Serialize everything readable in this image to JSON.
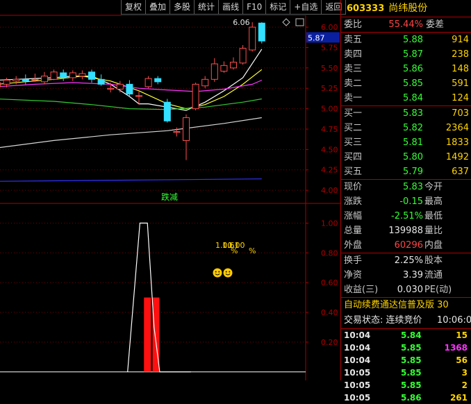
{
  "toolbar": [
    "复权",
    "叠加",
    "多股",
    "统计",
    "画线",
    "F10",
    "标记",
    "+自选",
    "返回"
  ],
  "stock": {
    "code": "603333",
    "name": "尚纬股份"
  },
  "weibi": {
    "label1": "委比",
    "value": "55.44%",
    "label2": "委差"
  },
  "sell_orders": [
    {
      "label": "卖五",
      "price": "5.88",
      "vol": "914"
    },
    {
      "label": "卖四",
      "price": "5.87",
      "vol": "238"
    },
    {
      "label": "卖三",
      "price": "5.86",
      "vol": "148"
    },
    {
      "label": "卖二",
      "price": "5.85",
      "vol": "591"
    },
    {
      "label": "卖一",
      "price": "5.84",
      "vol": "124"
    }
  ],
  "buy_orders": [
    {
      "label": "买一",
      "price": "5.83",
      "vol": "703"
    },
    {
      "label": "买二",
      "price": "5.82",
      "vol": "2364"
    },
    {
      "label": "买三",
      "price": "5.81",
      "vol": "1833"
    },
    {
      "label": "买四",
      "price": "5.80",
      "vol": "1492"
    },
    {
      "label": "买五",
      "price": "5.79",
      "vol": "637"
    }
  ],
  "quote": [
    {
      "label": "现价",
      "value": "5.83",
      "label2": "今开",
      "color": "green"
    },
    {
      "label": "涨跌",
      "value": "-0.15",
      "label2": "最高",
      "color": "green"
    },
    {
      "label": "涨幅",
      "value": "-2.51%",
      "label2": "最低",
      "color": "green"
    },
    {
      "label": "总量",
      "value": "139988",
      "label2": "量比",
      "color": "white"
    },
    {
      "label": "外盘",
      "value": "60296",
      "label2": "内盘",
      "color": "red"
    }
  ],
  "fundamentals": [
    {
      "label": "换手",
      "value": "2.25%",
      "label2": "股本"
    },
    {
      "label": "净资",
      "value": "3.39",
      "label2": "流通"
    },
    {
      "label": "收益(三)",
      "value": "0.030",
      "label2": "PE(动)"
    }
  ],
  "ticker_text": "自动续费通达信普及版 30",
  "status": {
    "label": "交易状态: 连续竞价",
    "time": "10:06:0"
  },
  "trades": [
    {
      "time": "10:04",
      "price": "5.84",
      "vol": "15",
      "pc": "green",
      "vc": "yellow"
    },
    {
      "time": "10:04",
      "price": "5.85",
      "vol": "1368",
      "pc": "green",
      "vc": "mag"
    },
    {
      "time": "10:04",
      "price": "5.85",
      "vol": "56",
      "pc": "green",
      "vc": "yellow"
    },
    {
      "time": "10:05",
      "price": "5.85",
      "vol": "3",
      "pc": "green",
      "vc": "yellow"
    },
    {
      "time": "10:05",
      "price": "5.85",
      "vol": "2",
      "pc": "green",
      "vc": "yellow"
    },
    {
      "time": "10:05",
      "price": "5.86",
      "vol": "261",
      "pc": "green",
      "vc": "yellow"
    }
  ],
  "chart_data": [
    {
      "type": "candlestick",
      "title": "",
      "y_ticks": [
        "6.00",
        "5.75",
        "5.50",
        "5.25",
        "5.00",
        "4.75",
        "4.50",
        "4.25",
        "4.00"
      ],
      "ylim": [
        3.95,
        6.12
      ],
      "current_price_label": "5.87",
      "high_label": "6.06",
      "candles": [
        {
          "o": 5.27,
          "c": 5.32,
          "h": 5.35,
          "l": 5.22
        },
        {
          "o": 5.3,
          "c": 5.35,
          "h": 5.38,
          "l": 5.26
        },
        {
          "o": 5.34,
          "c": 5.36,
          "h": 5.4,
          "l": 5.3
        },
        {
          "o": 5.36,
          "c": 5.34,
          "h": 5.42,
          "l": 5.3
        },
        {
          "o": 5.35,
          "c": 5.36,
          "h": 5.43,
          "l": 5.33
        },
        {
          "o": 5.33,
          "c": 5.4,
          "h": 5.45,
          "l": 5.3
        },
        {
          "o": 5.36,
          "c": 5.45,
          "h": 5.48,
          "l": 5.35
        },
        {
          "o": 5.44,
          "c": 5.38,
          "h": 5.48,
          "l": 5.34
        },
        {
          "o": 5.38,
          "c": 5.44,
          "h": 5.47,
          "l": 5.34
        },
        {
          "o": 5.4,
          "c": 5.43,
          "h": 5.47,
          "l": 5.36
        },
        {
          "o": 5.45,
          "c": 5.36,
          "h": 5.48,
          "l": 5.32
        },
        {
          "o": 5.36,
          "c": 5.3,
          "h": 5.42,
          "l": 5.28
        },
        {
          "o": 5.24,
          "c": 5.25,
          "h": 5.32,
          "l": 5.2
        },
        {
          "o": 5.24,
          "c": 5.3,
          "h": 5.34,
          "l": 5.2
        },
        {
          "o": 5.3,
          "c": 5.18,
          "h": 5.35,
          "l": 5.14
        },
        {
          "o": 5.16,
          "c": 5.16,
          "h": 5.22,
          "l": 5.05
        },
        {
          "o": 5.27,
          "c": 5.37,
          "h": 5.4,
          "l": 5.25
        },
        {
          "o": 5.37,
          "c": 5.33,
          "h": 5.4,
          "l": 5.3
        },
        {
          "o": 5.08,
          "c": 4.85,
          "h": 5.12,
          "l": 4.83
        },
        {
          "o": 4.71,
          "c": 4.72,
          "h": 4.77,
          "l": 4.66
        },
        {
          "o": 4.61,
          "c": 4.89,
          "h": 4.93,
          "l": 4.37
        },
        {
          "o": 5.0,
          "c": 5.3,
          "h": 5.32,
          "l": 4.98
        },
        {
          "o": 5.28,
          "c": 5.36,
          "h": 5.4,
          "l": 5.25
        },
        {
          "o": 5.36,
          "c": 5.55,
          "h": 5.62,
          "l": 5.33
        },
        {
          "o": 5.46,
          "c": 5.53,
          "h": 5.58,
          "l": 5.44
        },
        {
          "o": 5.5,
          "c": 5.57,
          "h": 5.63,
          "l": 5.48
        },
        {
          "o": 5.56,
          "c": 5.74,
          "h": 5.78,
          "l": 5.54
        },
        {
          "o": 5.72,
          "c": 6.0,
          "h": 6.06,
          "l": 5.7
        },
        {
          "o": 6.05,
          "c": 5.83,
          "h": 6.06,
          "l": 5.8
        }
      ],
      "ma_lines": [
        {
          "color": "#ffffff",
          "points": [
            [
              0,
              5.35
            ],
            [
              2,
              5.36
            ],
            [
              4,
              5.37
            ],
            [
              6,
              5.38
            ],
            [
              8,
              5.4
            ],
            [
              10,
              5.4
            ],
            [
              12,
              5.3
            ],
            [
              14,
              5.15
            ],
            [
              15,
              5.06
            ],
            [
              16,
              5.06
            ],
            [
              18,
              5.02
            ],
            [
              20,
              4.98
            ],
            [
              22,
              5.08
            ],
            [
              24,
              5.22
            ],
            [
              26,
              5.38
            ],
            [
              28,
              5.73
            ]
          ]
        },
        {
          "color": "#ffff33",
          "points": [
            [
              0,
              5.3
            ],
            [
              3,
              5.33
            ],
            [
              6,
              5.36
            ],
            [
              9,
              5.4
            ],
            [
              12,
              5.34
            ],
            [
              15,
              5.22
            ],
            [
              18,
              5.06
            ],
            [
              20,
              5.0
            ],
            [
              22,
              5.05
            ],
            [
              24,
              5.15
            ],
            [
              26,
              5.3
            ],
            [
              28,
              5.48
            ]
          ]
        },
        {
          "color": "#ff33ff",
          "points": [
            [
              0,
              5.27
            ],
            [
              4,
              5.3
            ],
            [
              8,
              5.32
            ],
            [
              12,
              5.3
            ],
            [
              15,
              5.25
            ],
            [
              18,
              5.23
            ],
            [
              21,
              5.21
            ],
            [
              24,
              5.24
            ],
            [
              27,
              5.3
            ],
            [
              28,
              5.35
            ]
          ]
        },
        {
          "color": "#33cc33",
          "points": [
            [
              0,
              5.12
            ],
            [
              6,
              5.09
            ],
            [
              10,
              5.05
            ],
            [
              14,
              5.0
            ],
            [
              18,
              4.99
            ],
            [
              22,
              5.02
            ],
            [
              26,
              5.08
            ],
            [
              28,
              5.12
            ]
          ]
        },
        {
          "color": "#d8d8d8",
          "points": [
            [
              0,
              4.52
            ],
            [
              6,
              4.61
            ],
            [
              12,
              4.68
            ],
            [
              18,
              4.73
            ],
            [
              24,
              4.82
            ],
            [
              28,
              4.89
            ]
          ]
        },
        {
          "color": "#3333ff",
          "points": [
            [
              0,
              4.11
            ],
            [
              28,
              4.14
            ]
          ]
        }
      ]
    },
    {
      "type": "line",
      "title": "",
      "panel_label": "跌减",
      "y_ticks": [
        "1.00",
        "0.80",
        "0.60",
        "0.40",
        "0.20"
      ],
      "ylim": [
        -0.02,
        1.1
      ],
      "line": [
        [
          13.8,
          0
        ],
        [
          15.1,
          1.0
        ],
        [
          15.9,
          1.0
        ],
        [
          16.6,
          0.3
        ],
        [
          17.2,
          0
        ],
        [
          20.5,
          0
        ]
      ],
      "bars": [
        {
          "x": 15.9,
          "value": 0.5
        },
        {
          "x": 16.8,
          "value": 0.5
        }
      ],
      "annotations": [
        "1.00",
        "1.61",
        "1.00",
        "%",
        "%"
      ],
      "smileys": 2
    }
  ]
}
